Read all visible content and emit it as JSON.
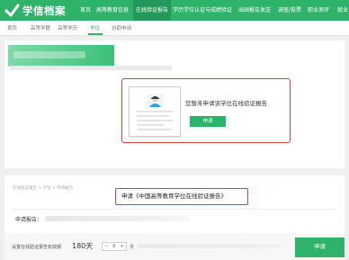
{
  "topnav": {
    "logo_text": "学信档案",
    "items": [
      {
        "label": "首页"
      },
      {
        "label": "高等教育信息"
      },
      {
        "label": "在线验证报告"
      },
      {
        "label": "学历学位认证与成绩验证"
      },
      {
        "label": "出国报告发送"
      },
      {
        "label": "调查/投票"
      },
      {
        "label": "职业测评"
      },
      {
        "label": "就业"
      }
    ],
    "active_index": 2
  },
  "subnav": {
    "items": [
      {
        "label": "首页"
      },
      {
        "label": "高等学籍"
      },
      {
        "label": "高等学历"
      },
      {
        "label": "学位"
      },
      {
        "label": "协助申请"
      }
    ],
    "active_index": 3
  },
  "card": {
    "message": "您暂未申请该学位在线验证报告",
    "apply_button": "申请"
  },
  "apply_form": {
    "breadcrumb": "在线验证报告 > 学位 > 申请报告",
    "title": "申请《中国高等教育学位在线验证报告》",
    "report_label": "申请报告：",
    "period_label": "设置在线验证报告有效期",
    "period_value": "180天",
    "stepper_value": "6",
    "stepper_unit": "月",
    "apply_button": "申请"
  },
  "colors": {
    "brand_green": "#2db36a",
    "highlight_red": "#d84040"
  }
}
